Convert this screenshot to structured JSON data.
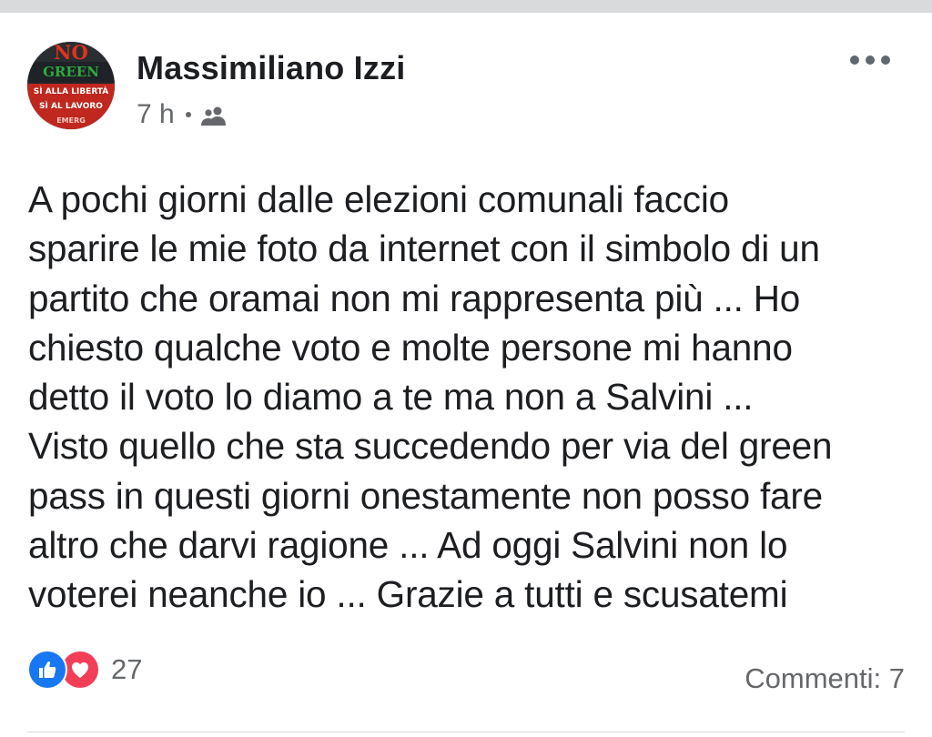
{
  "post": {
    "author": "Massimiliano Izzi",
    "time": "7 h",
    "audience_icon": "friends-icon",
    "avatar_text": {
      "line1": "NO",
      "line2": "GREEN PASS",
      "line3": "SÌ ALLA LIBERTÀ",
      "line4": "SÌ AL LAVORO",
      "line5": "EMERG"
    },
    "more_icon": "more-options-icon",
    "body": "A pochi giorni dalle elezioni comunali faccio\nsparire le mie foto da internet con il simbolo di un\npartito che oramai non mi rappresenta più ... Ho\nchiesto qualche voto e molte persone mi hanno\ndetto il voto lo diamo a te ma non a Salvini ...\nVisto quello che sta succedendo per via del green\npass in questi giorni onestamente non posso fare\naltro che darvi ragione  ... Ad oggi Salvini non lo\nvoterei neanche io ... Grazie a tutti e scusatemi",
    "reactions": {
      "icons": [
        "like-icon",
        "love-icon"
      ],
      "count": "27"
    },
    "comments": "Commenti: 7"
  },
  "colors": {
    "like": "#1877f2",
    "love": "#f33e58",
    "secondary_text": "#65676b",
    "primary_text": "#1c1e21"
  }
}
